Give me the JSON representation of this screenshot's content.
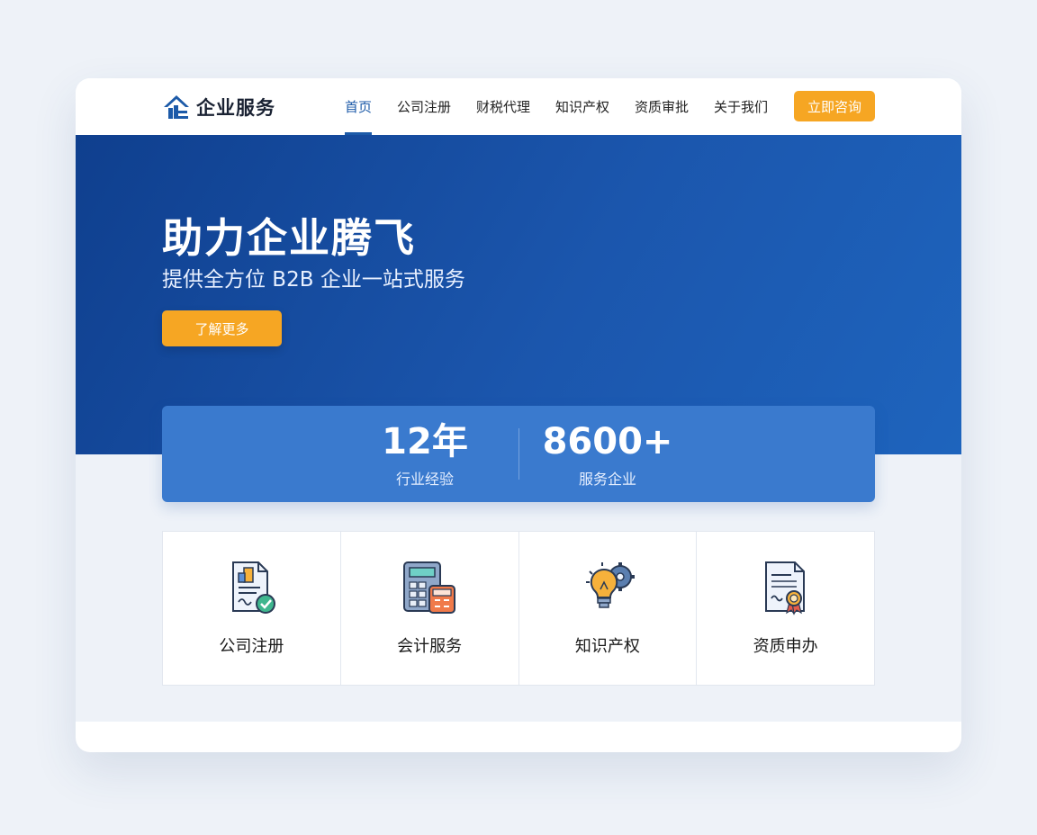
{
  "brand": {
    "mark": "企",
    "name": "企业服务",
    "color": "#1c5aa8",
    "accent": "#f6a623"
  },
  "nav": {
    "items": [
      {
        "label": "首页",
        "active": true
      },
      {
        "label": "公司注册"
      },
      {
        "label": "财税代理"
      },
      {
        "label": "知识产权"
      },
      {
        "label": "资质审批"
      },
      {
        "label": "关于我们"
      }
    ],
    "cta_label": "立即咨询"
  },
  "hero": {
    "title": "助力企业腾飞",
    "subtitle": "提供全方位 B2B 企业一站式服务",
    "button_label": "了解更多"
  },
  "stats": [
    {
      "value": "12年",
      "label": "行业经验"
    },
    {
      "value": "8600+",
      "label": "服务企业"
    }
  ],
  "services": [
    {
      "label": "公司注册",
      "icon": "company-registration-icon"
    },
    {
      "label": "会计服务",
      "icon": "calculator-icon"
    },
    {
      "label": "知识产权",
      "icon": "lightbulb-gear-icon"
    },
    {
      "label": "资质申办",
      "icon": "certificate-icon"
    }
  ]
}
